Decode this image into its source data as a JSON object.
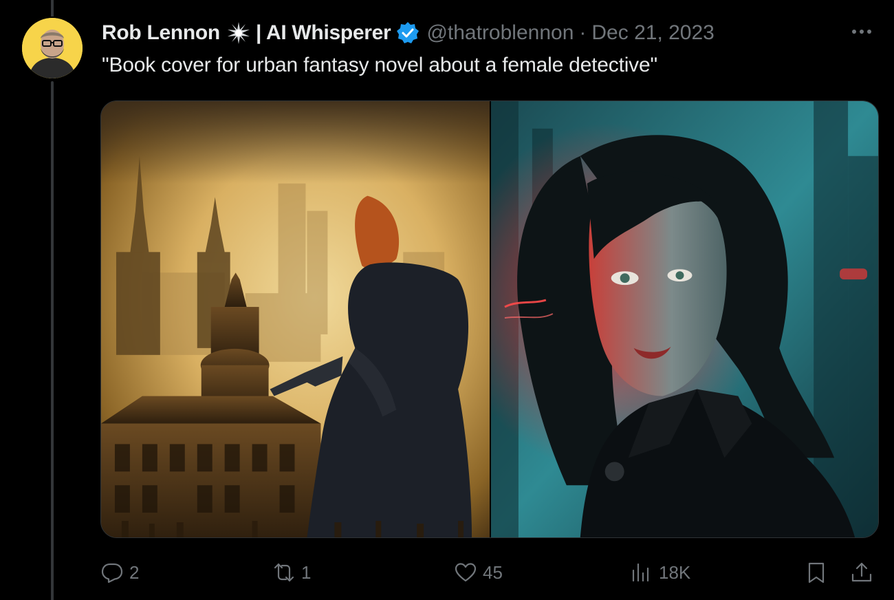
{
  "tweet": {
    "display_name": "Rob Lennon",
    "name_suffix": "| AI Whisperer",
    "handle": "@thatroblennon",
    "separator": "·",
    "date": "Dec 21, 2023",
    "text": "\"Book cover for urban fantasy novel about a female detective\""
  },
  "icons": {
    "avatar": "avatar",
    "spark": "spark-emoji-icon",
    "verified": "verified-badge-icon",
    "more": "more-options-icon"
  },
  "actions": {
    "reply_count": "2",
    "repost_count": "1",
    "like_count": "45",
    "views_count": "18K"
  },
  "colors": {
    "background": "#000000",
    "text_primary": "#e7e9ea",
    "text_secondary": "#71767b",
    "verified": "#1d9bf0",
    "avatar_bg": "#f7d44a"
  }
}
